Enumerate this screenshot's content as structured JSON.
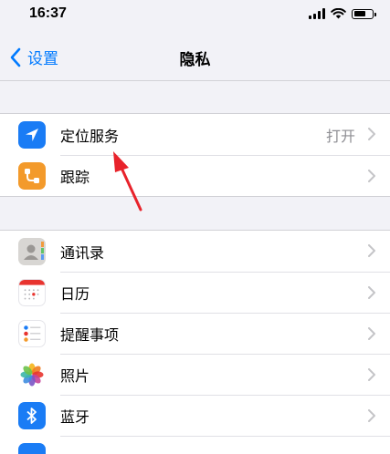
{
  "status": {
    "time": "16:37",
    "battery_level": 0.7
  },
  "nav": {
    "back_label": "设置",
    "title": "隐私"
  },
  "group1": [
    {
      "label": "定位服务",
      "detail": "打开",
      "icon": "location-arrow-icon",
      "color": "#1a7cf5"
    },
    {
      "label": "跟踪",
      "detail": "",
      "icon": "tracking-icon",
      "color": "#f39a2b"
    }
  ],
  "group2": [
    {
      "label": "通讯录",
      "icon": "contacts-icon"
    },
    {
      "label": "日历",
      "icon": "calendar-icon"
    },
    {
      "label": "提醒事项",
      "icon": "reminders-icon"
    },
    {
      "label": "照片",
      "icon": "photos-icon"
    },
    {
      "label": "蓝牙",
      "icon": "bluetooth-icon",
      "color": "#1a7cf5"
    }
  ],
  "colors": {
    "accent": "#007aff",
    "annotation_arrow": "#e8232b"
  }
}
